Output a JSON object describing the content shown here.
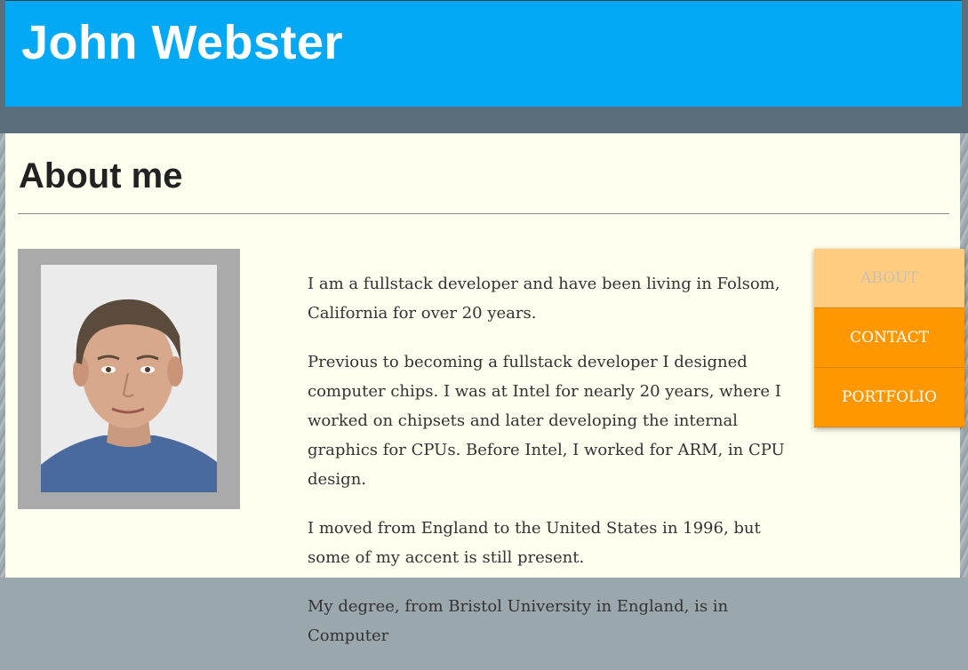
{
  "header": {
    "title": "John Webster"
  },
  "main": {
    "heading": "About me",
    "photo_alt": "Portrait of John Webster",
    "paragraphs": [
      "I am a fullstack developer and have been living in Folsom, California for over 20 years.",
      "Previous to becoming a fullstack developer I designed computer chips. I was at Intel for nearly 20 years, where I worked on chipsets and later developing the internal graphics for CPUs. Before Intel, I worked for ARM, in CPU design.",
      "I moved from England to the United States in 1996, but some of my accent is still present.",
      "My degree, from Bristol University in England, is in Computer"
    ]
  },
  "nav": {
    "items": [
      {
        "label": "ABOUT",
        "active": true
      },
      {
        "label": "CONTACT",
        "active": false
      },
      {
        "label": "PORTFOLIO",
        "active": false
      }
    ]
  },
  "colors": {
    "header": "#03a9f4",
    "header_band": "#5a6f7b",
    "content_bg": "#fffff0",
    "nav": "#ff9800",
    "nav_active": "#ffcc80"
  }
}
